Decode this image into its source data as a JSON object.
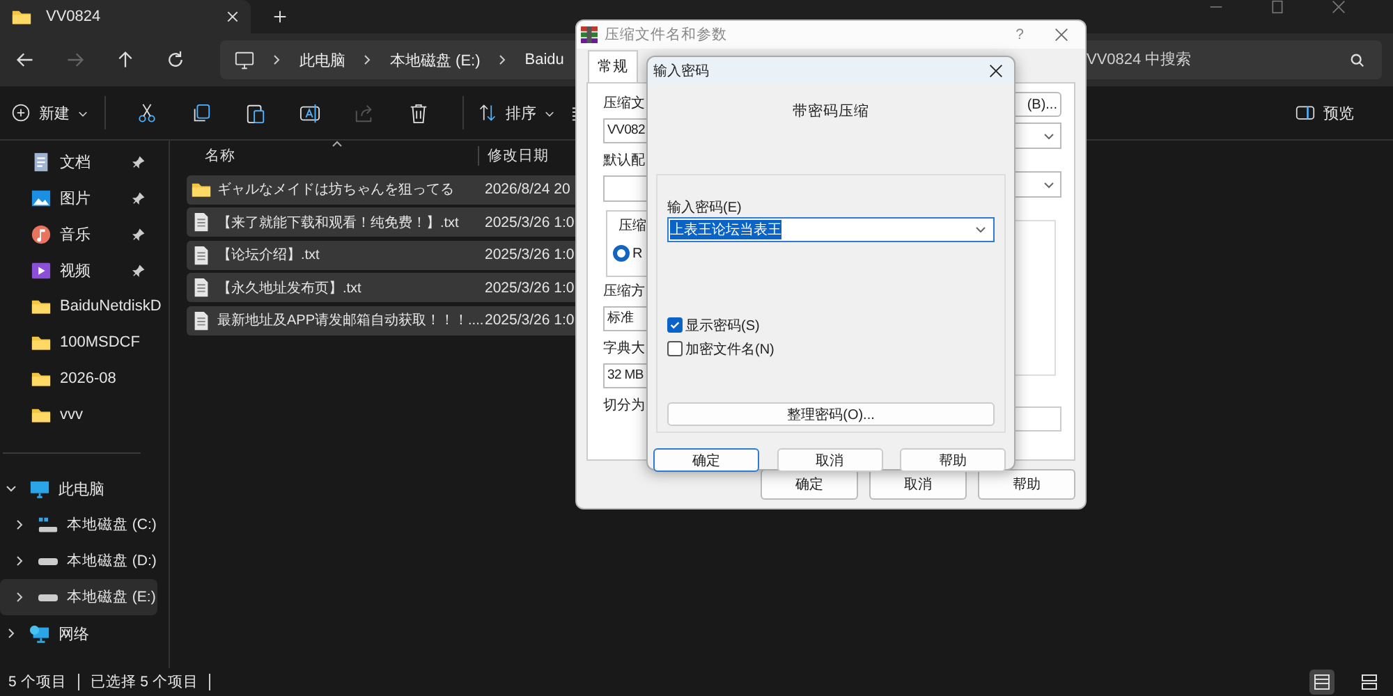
{
  "tab": {
    "title": "VV0824"
  },
  "address": {
    "crumbs": [
      "此电脑",
      "本地磁盘 (E:)",
      "Baidu"
    ],
    "search_placeholder": "VV0824 中搜索"
  },
  "toolbar": {
    "new": "新建",
    "sort": "排序",
    "preview": "预览"
  },
  "sidebar": {
    "quick_access": [
      {
        "label": "文档",
        "kind": "documents",
        "pinned": true,
        "selected": false
      },
      {
        "label": "图片",
        "kind": "pictures",
        "pinned": true,
        "selected": false
      },
      {
        "label": "音乐",
        "kind": "music",
        "pinned": true,
        "selected": false
      },
      {
        "label": "视频",
        "kind": "videos",
        "pinned": true,
        "selected": false
      },
      {
        "label": "BaiduNetdiskD",
        "kind": "folder",
        "pinned": false,
        "selected": false
      },
      {
        "label": "100MSDCF",
        "kind": "folder",
        "pinned": false,
        "selected": false
      },
      {
        "label": "2026-08",
        "kind": "folder",
        "pinned": false,
        "selected": false
      },
      {
        "label": "vvv",
        "kind": "folder",
        "pinned": false,
        "selected": false
      }
    ],
    "tree": [
      {
        "label": "此电脑",
        "kind": "pc",
        "expanded": true,
        "selected": false,
        "children": [
          {
            "label": "本地磁盘 (C:)",
            "kind": "system-drive",
            "expanded": false,
            "selected": false
          },
          {
            "label": "本地磁盘 (D:)",
            "kind": "drive",
            "expanded": false,
            "selected": false
          },
          {
            "label": "本地磁盘 (E:)",
            "kind": "drive",
            "expanded": false,
            "selected": true
          }
        ]
      },
      {
        "label": "网络",
        "kind": "network",
        "expanded": false,
        "selected": false
      }
    ]
  },
  "files": {
    "columns": [
      "名称",
      "修改日期"
    ],
    "rows": [
      {
        "kind": "folder",
        "name": "ギャルなメイドは坊ちゃんを狙ってる",
        "modified": "2026/8/24 20",
        "selected": true
      },
      {
        "kind": "text",
        "name": "【来了就能下载和观看！纯免费！】.txt",
        "modified": "2025/3/26 1:0",
        "selected": true
      },
      {
        "kind": "text",
        "name": "【论坛介绍】.txt",
        "modified": "2025/3/26 1:0",
        "selected": true
      },
      {
        "kind": "text",
        "name": "【永久地址发布页】.txt",
        "modified": "2025/3/26 1:0",
        "selected": true
      },
      {
        "kind": "text",
        "name": "最新地址及APP请发邮箱自动获取！！！....",
        "modified": "2025/3/26 1:0",
        "selected": true
      }
    ]
  },
  "status_bar": {
    "count": "5 个项目",
    "selection": "已选择 5 个项目"
  },
  "archive_dialog": {
    "title": "压缩文件名和参数",
    "help": "?",
    "tabs": [
      {
        "label": "常规",
        "selected": true
      }
    ],
    "name_label": "压缩文",
    "name_value": "VV082",
    "browse_button": "(B)...",
    "profile_label": "默认配",
    "format_group": "压缩",
    "format_option": {
      "label": "R",
      "selected": true
    },
    "method_label": "压缩方",
    "method_value": "标准",
    "dict_label": "字典大",
    "dict_value": "32 MB",
    "split_label": "切分为",
    "buttons": [
      "确定",
      "取消",
      "帮助"
    ]
  },
  "password_dialog": {
    "title": "输入密码",
    "heading": "带密码压缩",
    "password_label": "输入密码(E)",
    "password_value": "上表王论坛当表王",
    "options": [
      {
        "label": "显示密码(S)",
        "checked": true
      },
      {
        "label": "加密文件名(N)",
        "checked": false
      }
    ],
    "organize_button": "整理密码(O)...",
    "buttons": [
      {
        "label": "确定",
        "default": true
      },
      {
        "label": "取消",
        "default": false
      },
      {
        "label": "帮助",
        "default": false
      }
    ]
  }
}
